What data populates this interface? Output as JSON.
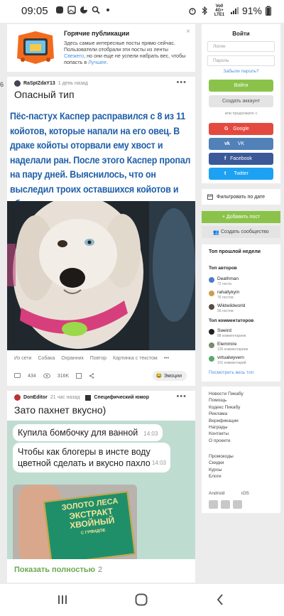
{
  "status_bar": {
    "time": "09:05",
    "battery": "91%",
    "network": "Vo0 4G+ LTE1"
  },
  "hot_posts": {
    "title": "Горячие публикации",
    "text_prefix": "Здесь самые интересные посты прямо сейчас. Пользователи отобрали эти посты из ленты ",
    "link_fresh": "Свежего",
    "text_mid": ", но они еще не успели набрать вес, чтобы попасть в ",
    "link_best": "Лучшее",
    "text_suffix": ".",
    "close": "×"
  },
  "post1": {
    "author": "RaSpIZdaY13",
    "time": "1 день назад",
    "title": "Опасный тип",
    "big_text": "Пёс-пастух Каспер расправился с 8 из 11 койотов, которые напали на его овец. В драке койоты оторвали ему хвост и наделали ран. После этого Каспер пропал на пару дней. Выяснилось, что он выследил троих оставшихся койотов и убил их тоже.",
    "tags": [
      "Из сети",
      "Собака",
      "Охранник",
      "Повтор",
      "Картинка с текстом",
      "•••"
    ],
    "comments": "434",
    "views": "316K",
    "emotions": "Эмоции",
    "side_number": "6"
  },
  "post2": {
    "author": "DonEditor",
    "time": "21 час назад",
    "community": "Специфический юмор",
    "title": "Зато пахнет вкусно)",
    "bubbles": [
      {
        "text": "Купила бомбочку для ванной",
        "time": "14:03"
      },
      {
        "text": "Чтобы как блогеры в инсте воду цветной сделать и вкусно пахло",
        "time": "14:03"
      }
    ],
    "package_text": [
      "ЗОЛОТО ЛЕСА",
      "ЭКСТРАКТ",
      "ХВОЙНЫЙ",
      "С ГРЯНДОЕ"
    ],
    "show_more": "Показать полностью",
    "show_more_count": "2"
  },
  "login": {
    "title": "Войти",
    "login_placeholder": "Логин",
    "password_placeholder": "Пароль",
    "forgot": "Забыли пароль?",
    "submit": "Войти",
    "create": "Создать аккаунт",
    "or_continue": "или продолжите с",
    "socials": [
      {
        "glyph": "G",
        "label": "Google",
        "color": "#e4493f"
      },
      {
        "glyph": "vk",
        "label": "VK",
        "color": "#5181b8"
      },
      {
        "glyph": "f",
        "label": "Facebook",
        "color": "#3b5998"
      },
      {
        "glyph": "t",
        "label": "Twitter",
        "color": "#1da1f2"
      }
    ]
  },
  "sidebar": {
    "filter": "Фильтровать по дате",
    "add_post": "Добавить пост",
    "create_community": "Создать сообщество",
    "top_week_title": "Топ прошлой недели",
    "top_authors_title": "Топ авторов",
    "authors": [
      {
        "name": "Deathman",
        "sub": "72 поста"
      },
      {
        "name": "rahatlykym",
        "sub": "76 постов"
      },
      {
        "name": "Wildwildworld",
        "sub": "56 постов"
      }
    ],
    "top_commenters_title": "Топ комментаторов",
    "commenters": [
      {
        "name": "Sweird",
        "sub": "88 комментариев"
      },
      {
        "name": "Elemmire",
        "sub": "126 комментариев"
      },
      {
        "name": "virtualwyvern",
        "sub": "101 комментарий"
      }
    ],
    "see_all": "Посмотреть весь топ",
    "links1": [
      "Новости Пикабу",
      "Помощь",
      "Кодекс Пикабу",
      "Реклама",
      "Верификации",
      "Награды",
      "Контакты",
      "О проекте"
    ],
    "links2": [
      "Промокоды",
      "Скидки",
      "Курсы",
      "Блоги"
    ],
    "os_android": "Android",
    "os_ios": "iOS"
  }
}
